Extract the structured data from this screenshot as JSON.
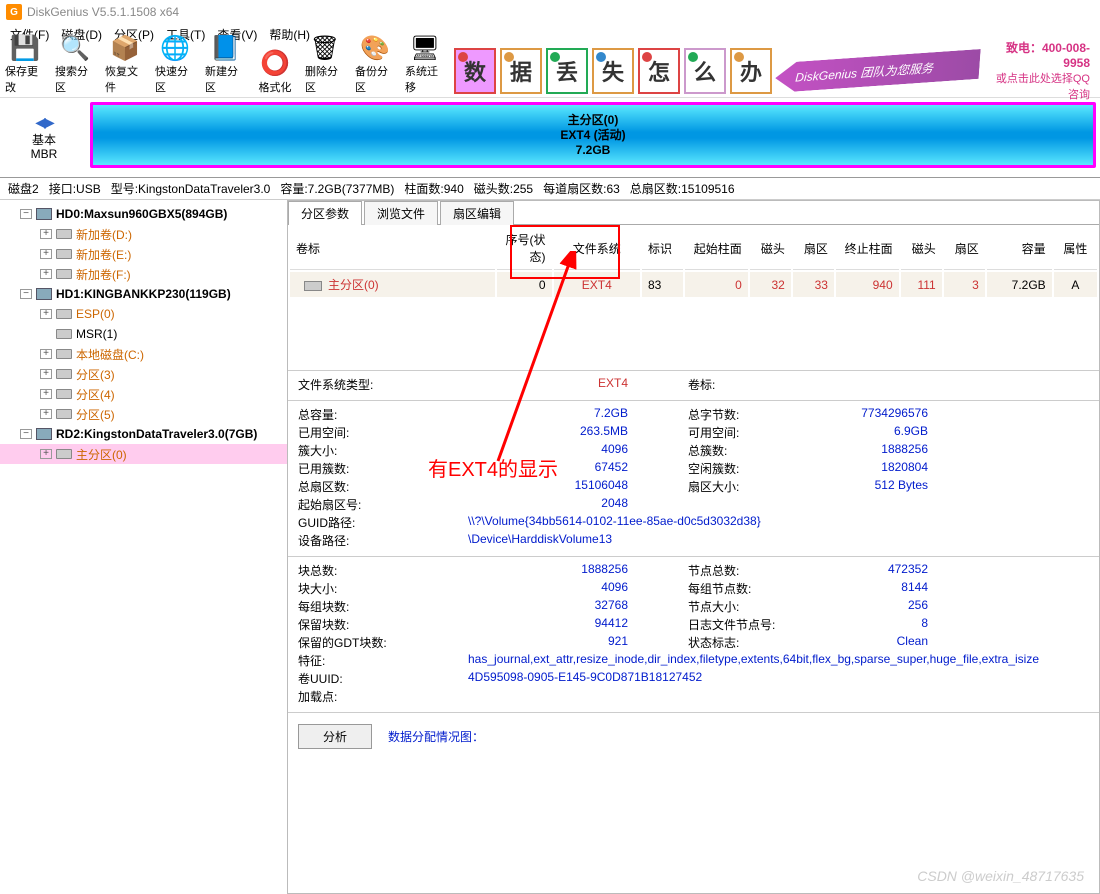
{
  "title": "DiskGenius V5.5.1.1508 x64",
  "menu": [
    "文件(F)",
    "磁盘(D)",
    "分区(P)",
    "工具(T)",
    "查看(V)",
    "帮助(H)"
  ],
  "toolbar": [
    {
      "label": "保存更改",
      "icon": "💾"
    },
    {
      "label": "搜索分区",
      "icon": "🔍"
    },
    {
      "label": "恢复文件",
      "icon": "📦"
    },
    {
      "label": "快速分区",
      "icon": "🌐"
    },
    {
      "label": "新建分区",
      "icon": "📘"
    },
    {
      "label": "格式化",
      "icon": "⭕"
    },
    {
      "label": "删除分区",
      "icon": "🗑"
    },
    {
      "label": "备份分区",
      "icon": "🎨"
    },
    {
      "label": "系统迁移",
      "icon": "🖥"
    }
  ],
  "promo": {
    "chars": [
      "数",
      "据",
      "丢",
      "失",
      "怎",
      "么",
      "办"
    ],
    "arrow": "DiskGenius 团队为您服务",
    "tel_label": "致电：",
    "tel": "400-008-9958",
    "qq": "或点击此处选择QQ咨询"
  },
  "overview": {
    "basic": "基本",
    "mbr": "MBR",
    "line1": "主分区(0)",
    "line2": "EXT4 (活动)",
    "line3": "7.2GB"
  },
  "summary": {
    "disk": "磁盘2",
    "if": "接口:USB",
    "model": "型号:KingstonDataTraveler3.0",
    "cap": "容量:7.2GB(7377MB)",
    "cyl": "柱面数:940",
    "head": "磁头数:255",
    "spt": "每道扇区数:63",
    "total": "总扇区数:15109516"
  },
  "tree": [
    {
      "lvl": 0,
      "exp": "−",
      "icn": "hdd",
      "txt": "HD0:Maxsun960GBX5(894GB)",
      "bold": true
    },
    {
      "lvl": 1,
      "exp": "+",
      "icn": "drv",
      "txt": "新加卷(D:)",
      "cls": "orange"
    },
    {
      "lvl": 1,
      "exp": "+",
      "icn": "drv",
      "txt": "新加卷(E:)",
      "cls": "orange"
    },
    {
      "lvl": 1,
      "exp": "+",
      "icn": "drv",
      "txt": "新加卷(F:)",
      "cls": "orange"
    },
    {
      "lvl": 0,
      "exp": "−",
      "icn": "hdd",
      "txt": "HD1:KINGBANKKP230(119GB)",
      "bold": true
    },
    {
      "lvl": 1,
      "exp": "+",
      "icn": "drv",
      "txt": "ESP(0)",
      "cls": "orange"
    },
    {
      "lvl": 1,
      "exp": "",
      "icn": "drv",
      "txt": "MSR(1)"
    },
    {
      "lvl": 1,
      "exp": "+",
      "icn": "drv",
      "txt": "本地磁盘(C:)",
      "cls": "orange"
    },
    {
      "lvl": 1,
      "exp": "+",
      "icn": "drv",
      "txt": "分区(3)",
      "cls": "orange"
    },
    {
      "lvl": 1,
      "exp": "+",
      "icn": "drv",
      "txt": "分区(4)",
      "cls": "orange"
    },
    {
      "lvl": 1,
      "exp": "+",
      "icn": "drv",
      "txt": "分区(5)",
      "cls": "orange"
    },
    {
      "lvl": 0,
      "exp": "−",
      "icn": "hdd",
      "txt": "RD2:KingstonDataTraveler3.0(7GB)",
      "bold": true
    },
    {
      "lvl": 1,
      "exp": "+",
      "icn": "drv",
      "txt": "主分区(0)",
      "cls": "orange",
      "sel": true
    }
  ],
  "tabs": [
    "分区参数",
    "浏览文件",
    "扇区编辑"
  ],
  "part_table": {
    "headers": [
      "卷标",
      "序号(状态)",
      "文件系统",
      "标识",
      "起始柱面",
      "磁头",
      "扇区",
      "终止柱面",
      "磁头",
      "扇区",
      "容量",
      "属性"
    ],
    "row": {
      "name": "主分区(0)",
      "idx": "0",
      "fs": "EXT4",
      "flag": "83",
      "sc": "0",
      "sh": "32",
      "ss": "33",
      "ec": "940",
      "eh": "111",
      "es": "3",
      "cap": "7.2GB",
      "attr": "A"
    }
  },
  "annot": "有EXT4的显示",
  "fs": {
    "fstype_label": "文件系统类型:",
    "fstype": "EXT4",
    "vol_label": "卷标:",
    "total_label": "总容量:",
    "total": "7.2GB",
    "bytes_label": "总字节数:",
    "bytes": "7734296576",
    "used_label": "已用空间:",
    "used": "263.5MB",
    "avail_label": "可用空间:",
    "avail": "6.9GB",
    "clsz_label": "簇大小:",
    "clsz": "4096",
    "totcl_label": "总簇数:",
    "totcl": "1888256",
    "usedcl_label": "已用簇数:",
    "usedcl": "67452",
    "freecl_label": "空闲簇数:",
    "freecl": "1820804",
    "sec_label": "总扇区数:",
    "sec": "15106048",
    "secsz_label": "扇区大小:",
    "secsz": "512 Bytes",
    "startsec_label": "起始扇区号:",
    "startsec": "2048",
    "guid_label": "GUID路径:",
    "guid": "\\\\?\\Volume{34bb5614-0102-11ee-85ae-d0c5d3032d38}",
    "dev_label": "设备路径:",
    "dev": "\\Device\\HarddiskVolume13",
    "blocks_label": "块总数:",
    "blocks": "1888256",
    "inodes_label": "节点总数:",
    "inodes": "472352",
    "blksz_label": "块大小:",
    "blksz": "4096",
    "ipg_label": "每组节点数:",
    "ipg": "8144",
    "bpg_label": "每组块数:",
    "bpg": "32768",
    "isz_label": "节点大小:",
    "isz": "256",
    "resv_label": "保留块数:",
    "resv": "94412",
    "jrn_label": "日志文件节点号:",
    "jrn": "8",
    "gdt_label": "保留的GDT块数:",
    "gdt": "921",
    "state_label": "状态标志:",
    "state": "Clean",
    "feat_label": "特征:",
    "feat": "has_journal,ext_attr,resize_inode,dir_index,filetype,extents,64bit,flex_bg,sparse_super,huge_file,extra_isize",
    "uuid_label": "卷UUID:",
    "uuid": "4D595098-0905-E145-9C0D871B18127452",
    "mnt_label": "加载点:"
  },
  "analyze_btn": "分析",
  "alloc_label": "数据分配情况图：",
  "watermark": "CSDN @weixin_48717635"
}
